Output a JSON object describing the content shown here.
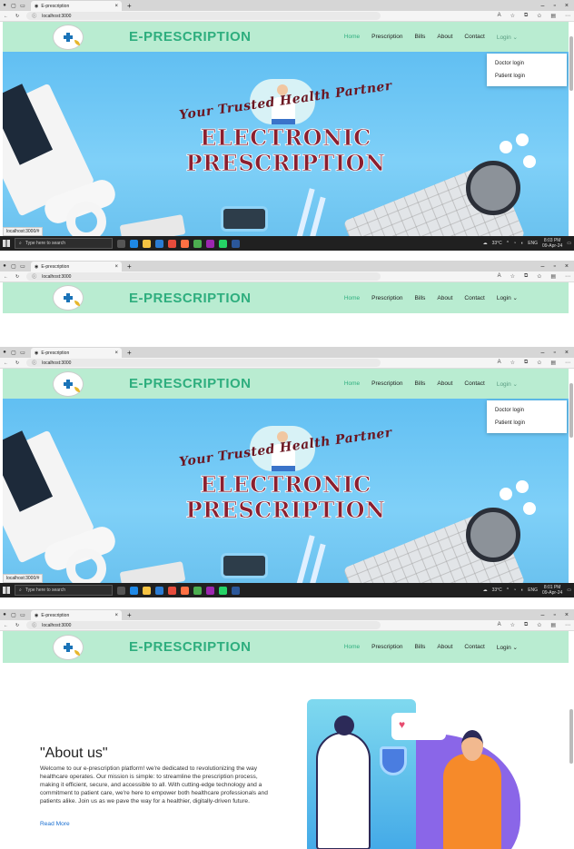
{
  "browser": {
    "tab_title": "E-prescription",
    "url": "localhost:3000",
    "new_tab": "+",
    "close": "×"
  },
  "navbar": {
    "brand": "E-PRESCRIPTION",
    "links": [
      "Home",
      "Prescription",
      "Bills",
      "About",
      "Contact"
    ],
    "login_label": "Login"
  },
  "dropdown": {
    "items": [
      "Doctor login",
      "Patient login"
    ]
  },
  "hero": {
    "tagline": "Your Trusted Health Partner",
    "title_line1": "ELECTRONIC",
    "title_line2": "PRESCRIPTION",
    "status_url": "localhost:3000/#"
  },
  "taskbar": {
    "search_placeholder": "Type here to search",
    "weather": "33°C",
    "language": "ENG",
    "time_1": "8:03 PM",
    "time_2": "8:01 PM",
    "date": "09-Apr-24"
  },
  "about": {
    "title": "\"About us\"",
    "text": "Welcome to our e-prescription platform! we're dedicated to revolutionizing the way healthcare operates. Our mission is simple: to streamline the prescription process, making it efficient, secure, and accessible to all. With cutting-edge technology and a commitment to patient care, we're here to empower both healthcare professionals and patients alike. Join us as we pave the way for a healthier, digitally-driven future.",
    "read_more": "Read More"
  },
  "colors": {
    "navbar_bg": "#b9ecd1",
    "brand": "#2eae7e",
    "hero_title": "#8b1f2f",
    "link": "#1a6fd1"
  }
}
